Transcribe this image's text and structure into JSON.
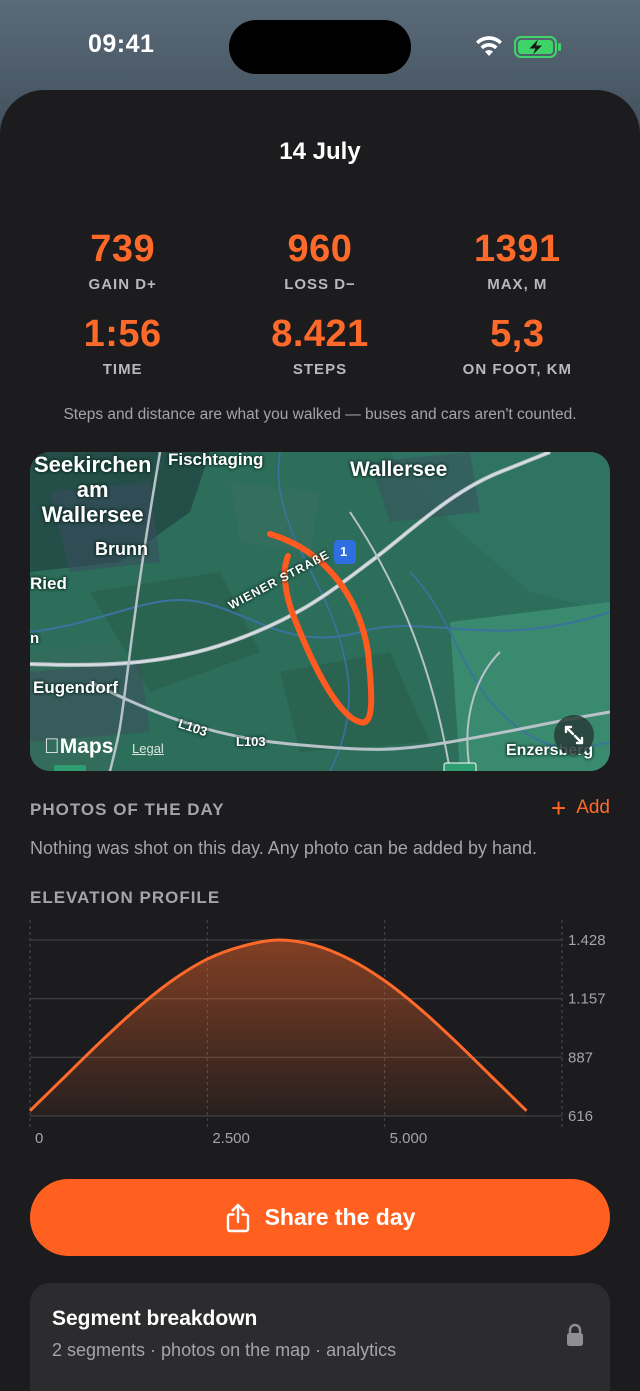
{
  "status_bar": {
    "time": "09:41",
    "wifi_icon": "wifi-icon",
    "battery_icon": "battery-charging-icon"
  },
  "header": {
    "date": "14 July"
  },
  "stats": [
    {
      "value": "739",
      "label": "GAIN D+"
    },
    {
      "value": "960",
      "label": "LOSS D−"
    },
    {
      "value": "1391",
      "label": "MAX, M"
    },
    {
      "value": "1:56",
      "label": "TIME"
    },
    {
      "value": "8.421",
      "label": "STEPS"
    },
    {
      "value": "5,3",
      "label": "ON FOOT, KM"
    }
  ],
  "steps_note": "Steps and distance are what you walked — buses and cars aren't counted.",
  "map": {
    "labels": {
      "seekirchen": "Seekirchen\nam\nWallersee",
      "fischtaging": "Fischtaging",
      "wallersee": "Wallersee",
      "brunn": "Brunn",
      "ried": "Ried",
      "eugendorf": "Eugendorf",
      "wiener_strasse": "WIENER STRAßE",
      "l103_a": "L103",
      "l103_b": "L103",
      "enzersberg": "Enzersberg",
      "road_1": "1",
      "n_edge": "n"
    },
    "attribution": "Maps",
    "legal": "Legal",
    "route_color": "#ff5a1f"
  },
  "photos": {
    "header": "PHOTOS OF THE DAY",
    "add_label": "Add",
    "note": "Nothing was shot on this day. Any photo can be added by hand."
  },
  "elevation": {
    "header": "ELEVATION PROFILE",
    "y_ticks": [
      "1.428",
      "1.157",
      "887",
      "616"
    ],
    "x_ticks": [
      "0",
      "2.500",
      "5.000"
    ]
  },
  "chart_data": {
    "type": "area",
    "title": "ELEVATION PROFILE",
    "x": [
      0,
      500,
      1000,
      1500,
      2000,
      2500,
      3000,
      3500,
      4000,
      4500,
      5000,
      5500,
      6000,
      6500,
      7000
    ],
    "series": [
      {
        "values": [
          640,
          800,
          960,
          1110,
          1240,
          1340,
          1400,
          1428,
          1405,
          1340,
          1240,
          1110,
          960,
          800,
          640
        ]
      }
    ],
    "xlim": [
      0,
      7500
    ],
    "ylim": [
      616,
      1428
    ],
    "y_ticks": [
      616,
      887,
      1157,
      1428
    ],
    "x_ticks": [
      0,
      2500,
      5000
    ],
    "color": "#ff6a2a",
    "grid": true
  },
  "share": {
    "label": "Share the day",
    "icon": "share-icon"
  },
  "segment": {
    "title": "Segment breakdown",
    "subtitle": "2 segments · photos on the map · analytics",
    "icon": "lock-icon"
  },
  "colors": {
    "accent": "#ff6a2a",
    "button": "#ff6020",
    "sheet": "#1c1c1e",
    "card": "#2c2c2e"
  }
}
